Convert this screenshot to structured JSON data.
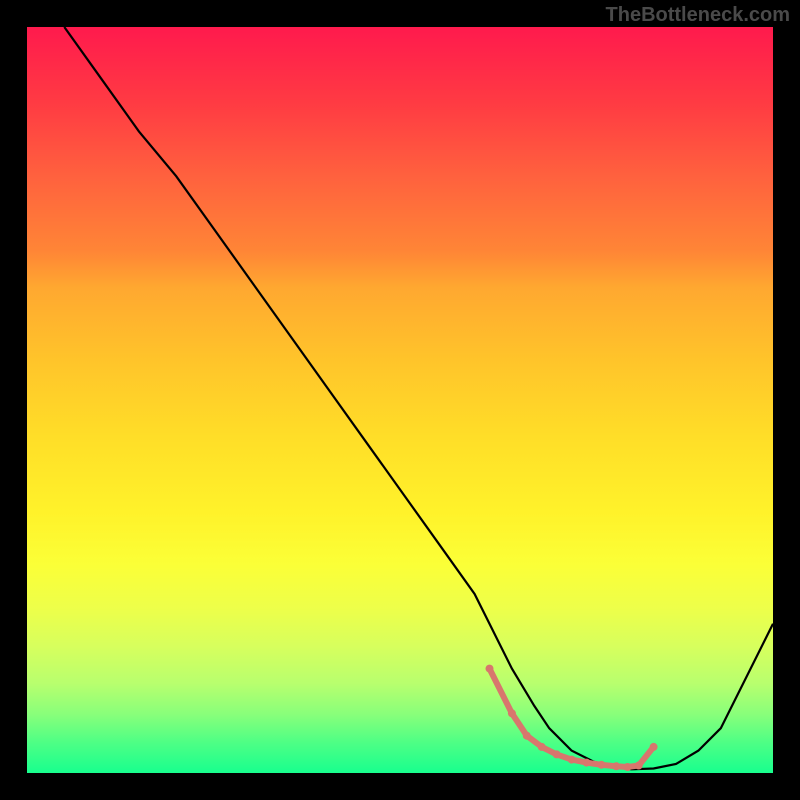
{
  "watermark": "TheBottleneck.com",
  "chart_data": {
    "type": "line",
    "title": "",
    "xlabel": "",
    "ylabel": "",
    "xlim": [
      0,
      100
    ],
    "ylim": [
      0,
      100
    ],
    "series": [
      {
        "name": "bottleneck-curve",
        "x": [
          5,
          10,
          15,
          20,
          25,
          30,
          35,
          40,
          45,
          50,
          55,
          60,
          62,
          65,
          68,
          70,
          73,
          76,
          79,
          81,
          84,
          87,
          90,
          93,
          100
        ],
        "y": [
          100,
          93,
          86,
          80,
          73,
          66,
          59,
          52,
          45,
          38,
          31,
          24,
          20,
          14,
          9,
          6,
          3,
          1.5,
          0.8,
          0.5,
          0.6,
          1.2,
          3,
          6,
          20
        ]
      }
    ],
    "flat_region_markers": {
      "color": "#d8766d",
      "x": [
        62,
        65,
        67,
        69,
        71,
        73,
        75,
        77,
        79,
        80.5,
        82,
        84
      ],
      "y": [
        14,
        8,
        5,
        3.5,
        2.5,
        1.8,
        1.4,
        1.1,
        0.9,
        0.8,
        1.0,
        3.5
      ]
    },
    "gradient_stops": [
      {
        "pos": 0,
        "color": "#ff1a4d"
      },
      {
        "pos": 10,
        "color": "#ff3a43"
      },
      {
        "pos": 20,
        "color": "#ff613e"
      },
      {
        "pos": 30,
        "color": "#ff8536"
      },
      {
        "pos": 35,
        "color": "#ffa830"
      },
      {
        "pos": 45,
        "color": "#ffc52a"
      },
      {
        "pos": 55,
        "color": "#ffde28"
      },
      {
        "pos": 65,
        "color": "#fff22a"
      },
      {
        "pos": 72,
        "color": "#fbff37"
      },
      {
        "pos": 78,
        "color": "#edff4a"
      },
      {
        "pos": 83,
        "color": "#d7ff5d"
      },
      {
        "pos": 88,
        "color": "#b8ff6e"
      },
      {
        "pos": 92,
        "color": "#8aff7a"
      },
      {
        "pos": 96,
        "color": "#4dff85"
      },
      {
        "pos": 100,
        "color": "#18ff8e"
      }
    ]
  }
}
